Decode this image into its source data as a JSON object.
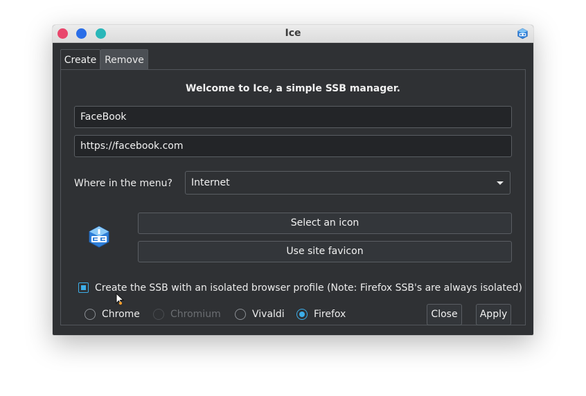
{
  "window": {
    "title": "Ice"
  },
  "tabs": [
    {
      "label": "Create",
      "active": true
    },
    {
      "label": "Remove",
      "active": false
    }
  ],
  "create": {
    "welcome": "Welcome to Ice, a simple SSB manager.",
    "name_value": "FaceBook",
    "url_value": "https://facebook.com",
    "menu_label": "Where in the menu?",
    "menu_selected": "Internet",
    "select_icon_label": "Select an icon",
    "favicon_label": "Use site favicon",
    "isolated_checked": true,
    "isolated_label": "Create the SSB with an isolated browser profile (Note: Firefox SSB's are always isolated)",
    "browsers": [
      {
        "label": "Chrome",
        "checked": false,
        "disabled": false
      },
      {
        "label": "Chromium",
        "checked": false,
        "disabled": true
      },
      {
        "label": "Vivaldi",
        "checked": false,
        "disabled": false
      },
      {
        "label": "Firefox",
        "checked": true,
        "disabled": false
      }
    ],
    "close_label": "Close",
    "apply_label": "Apply"
  },
  "colors": {
    "accent": "#3daee9",
    "window_bg": "#2f3134",
    "titlebar_bg": "#e4e4e4",
    "close": "#e9466c",
    "minimize": "#2a6ee8",
    "maximize": "#2ab7b9"
  },
  "icons": {
    "app": "ice-logo-icon",
    "window": "ice-logo-icon",
    "menu_caret": "chevron-down-icon"
  }
}
